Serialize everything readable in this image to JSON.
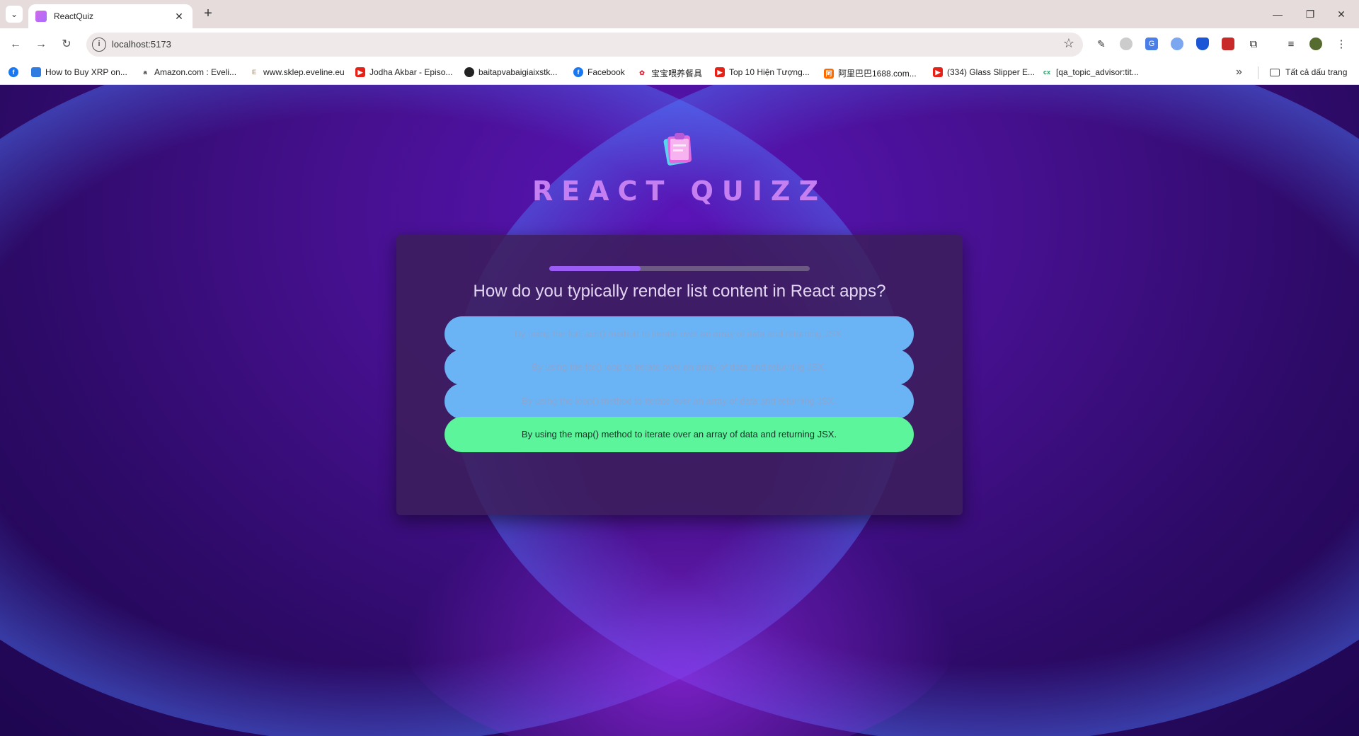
{
  "browser": {
    "tab_title": "ReactQuiz",
    "tab_close": "✕",
    "new_tab": "+",
    "url": "localhost:5173",
    "window_controls": {
      "minimize": "—",
      "restore": "❐",
      "close": "✕"
    },
    "bookmarks": [
      {
        "label": "How to Buy XRP on...",
        "icon": "x-network-icon",
        "color": "#2f7de1"
      },
      {
        "label": "Amazon.com : Eveli...",
        "icon": "amazon-icon",
        "color": "#222222"
      },
      {
        "label": "www.sklep.eveline.eu",
        "icon": "eveline-icon",
        "color": "#b8a48a"
      },
      {
        "label": "Jodha Akbar - Episo...",
        "icon": "youtube-icon",
        "color": "#e62117"
      },
      {
        "label": "baitapvabaigiaixstk...",
        "icon": "globe-icon",
        "color": "#222222"
      },
      {
        "label": "Facebook",
        "icon": "facebook-icon",
        "color": "#1877f2"
      },
      {
        "label": "宝宝喂养餐具",
        "icon": "weibo-icon",
        "color": "#e6162d"
      },
      {
        "label": "Top 10 Hiện Tượng...",
        "icon": "youtube-icon",
        "color": "#e62117"
      },
      {
        "label": "阿里巴巴1688.com...",
        "icon": "alibaba-icon",
        "color": "#ff6a00"
      },
      {
        "label": "(334) Glass Slipper E...",
        "icon": "youtube-icon",
        "color": "#e62117"
      },
      {
        "label": "[qa_topic_advisor:tit...",
        "icon": "cx-icon",
        "color": "#1aa260"
      }
    ],
    "all_bookmarks": "Tất cả dấu trang"
  },
  "quiz": {
    "title": "REACT QUIZZ",
    "progress": 0.35,
    "question": "How do you typically render list content in React apps?",
    "answers": [
      "By using the forEach() method to iterate over an array of data and returning JSX.",
      "By using the for() loop to iterate over an array of data and returning JSX.",
      "By using the loop() method to iterate over an array of data and returning JSX.",
      "By using the map() method to iterate over an array of data and returning JSX."
    ],
    "correct_index": 3
  },
  "colors": {
    "title": "#c57ff0",
    "answer_default": "#6ab4f5",
    "answer_correct": "#5cf59c",
    "progress_fill": "#9b5cf6"
  }
}
